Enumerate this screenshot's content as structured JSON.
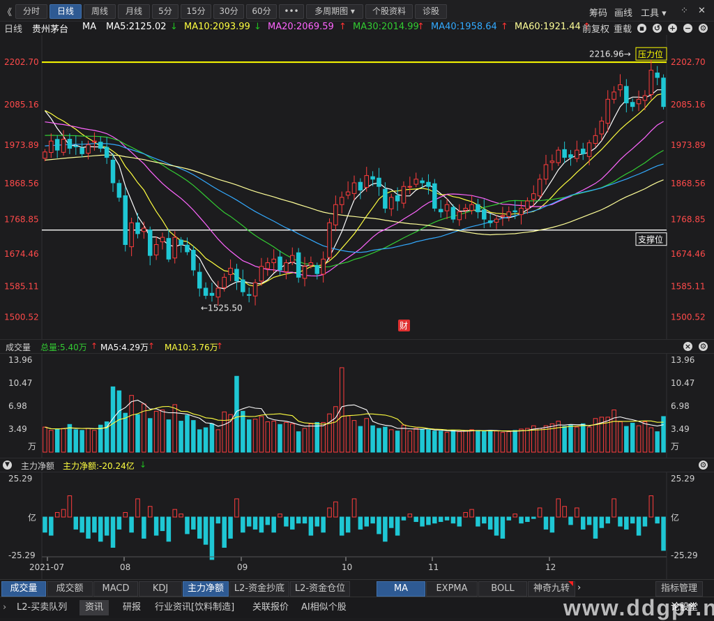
{
  "toolbar": {
    "back_glyph": "《",
    "tabs": [
      {
        "label": "分时",
        "w": 44
      },
      {
        "label": "日线",
        "w": 44,
        "active": true
      },
      {
        "label": "周线",
        "w": 44
      },
      {
        "label": "月线",
        "w": 44
      },
      {
        "label": "5分",
        "w": 36
      },
      {
        "label": "15分",
        "w": 42
      },
      {
        "label": "30分",
        "w": 42
      },
      {
        "label": "60分",
        "w": 42
      },
      {
        "label": "•••",
        "w": 34
      },
      {
        "label": "多周期图 ▾",
        "w": 80
      },
      {
        "label": "个股资料",
        "w": 66
      },
      {
        "label": "诊股",
        "w": 44
      }
    ],
    "right": {
      "chip": "筹码",
      "draw": "画线",
      "tools": "工具 ▾",
      "grid_icon": "⁘",
      "close_icon": "✕"
    }
  },
  "ma_bar": {
    "period": "日线",
    "stock": "贵州茅台",
    "indicator": "MA",
    "items": [
      {
        "label": "MA5:2125.02",
        "arrow": "↓",
        "color": "#ffffff",
        "arrow_color": "#20c020"
      },
      {
        "label": "MA10:2093.99",
        "arrow": "↓",
        "color": "#ffff40",
        "arrow_color": "#20c020"
      },
      {
        "label": "MA20:2069.59",
        "arrow": "↑",
        "color": "#ff66ff",
        "arrow_color": "#ff3333"
      },
      {
        "label": "MA30:2014.99",
        "arrow": "↑",
        "color": "#33cc33",
        "arrow_color": "#ff3333"
      },
      {
        "label": "MA40:1958.64",
        "arrow": "↑",
        "color": "#33aaff",
        "arrow_color": "#ff3333"
      },
      {
        "label": "MA60:1921.44",
        "arrow": "↑",
        "color": "#ffff99",
        "arrow_color": "#ff3333"
      }
    ],
    "right": {
      "adjust": "前复权",
      "overlay": "重载"
    }
  },
  "volume_bar": {
    "title": "成交量",
    "items": [
      {
        "label": "总量:5.40万",
        "arrow": "↑",
        "color": "#33cc33"
      },
      {
        "label": "MA5:4.29万",
        "arrow": "↑",
        "color": "#ffffff"
      },
      {
        "label": "MA10:3.76万",
        "arrow": "↑",
        "color": "#ffff40"
      }
    ]
  },
  "flow_bar": {
    "title": "主力净额",
    "value": "主力净额:-20.24亿",
    "arrow": "↓"
  },
  "bottom_tabs": [
    {
      "label": "成交量",
      "active": true,
      "w": 62
    },
    {
      "label": "成交额",
      "w": 64
    },
    {
      "label": "MACD",
      "w": 62
    },
    {
      "label": "KDJ",
      "w": 60
    },
    {
      "label": "主力净额",
      "active": true,
      "w": 64
    },
    {
      "label": "L2-资金抄底",
      "w": 84
    },
    {
      "label": "L2-资金仓位",
      "w": 84
    },
    {
      "label": "MA",
      "active": true,
      "w": 68
    },
    {
      "label": "EXPMA",
      "w": 72
    },
    {
      "label": "BOLL",
      "w": 68
    },
    {
      "label": "神奇九转",
      "w": 66
    }
  ],
  "bottom_right": "指标管理",
  "status_tabs": [
    {
      "label": "L2-买卖队列"
    },
    {
      "label": "资讯",
      "active": true
    },
    {
      "label": "研报"
    },
    {
      "label": "行业资讯[饮料制造]"
    },
    {
      "label": "关联报价"
    },
    {
      "label": "AI相似个股"
    }
  ],
  "status_right": "论股堂",
  "watermark": "www.ddgpr.net",
  "colors": {
    "up": "#ff3d3d",
    "down": "#1fc7d4",
    "support": "#ffffff",
    "resistance": "#ffff00"
  },
  "chart_data": [
    {
      "type": "candlestick",
      "title": "贵州茅台 日线",
      "y_ticks": [
        2202.7,
        2085.16,
        1973.89,
        1868.56,
        1768.85,
        1674.46,
        1585.11,
        1500.52
      ],
      "ylim": [
        1482,
        2235
      ],
      "x_ticks": [
        "2021-07",
        "08",
        "09",
        "10",
        "11",
        "12"
      ],
      "annotations": {
        "high_label": "2216.96",
        "low_label": "1525.50",
        "resistance_label": "压力位",
        "support_label": "支撑位",
        "event_marker": "财"
      },
      "resistance_level": 2202,
      "support_level": 1740,
      "closes": [
        1955,
        1985,
        1960,
        1990,
        1965,
        1970,
        1950,
        1975,
        1985,
        1965,
        1940,
        1870,
        1830,
        1700,
        1760,
        1730,
        1745,
        1670,
        1700,
        1720,
        1660,
        1720,
        1700,
        1680,
        1630,
        1580,
        1560,
        1560,
        1580,
        1610,
        1635,
        1600,
        1570,
        1560,
        1595,
        1640,
        1650,
        1660,
        1630,
        1650,
        1670,
        1610,
        1640,
        1650,
        1620,
        1660,
        1760,
        1810,
        1830,
        1845,
        1870,
        1850,
        1890,
        1880,
        1860,
        1800,
        1830,
        1820,
        1860,
        1860,
        1880,
        1870,
        1860,
        1800,
        1790,
        1810,
        1770,
        1790,
        1800,
        1810,
        1790,
        1770,
        1760,
        1770,
        1780,
        1790,
        1790,
        1800,
        1820,
        1840,
        1880,
        1920,
        1930,
        1960,
        1940,
        1940,
        1960,
        1950,
        1980,
        2000,
        2040,
        2100,
        2120,
        2140,
        2090,
        2080,
        2100,
        2110,
        2180,
        2160,
        2080
      ]
    },
    {
      "type": "bar",
      "title": "成交量",
      "unit": "万",
      "y_ticks": [
        13.96,
        10.47,
        6.98,
        3.49
      ],
      "ylim": [
        0,
        13.96
      ],
      "values": [
        3.8,
        3.3,
        3.5,
        3.6,
        4.2,
        3.4,
        3.3,
        3.6,
        3.3,
        4.1,
        4.6,
        9.9,
        9.3,
        5.9,
        8.6,
        5.7,
        7.3,
        5.1,
        6.2,
        6.4,
        4.9,
        7.2,
        4.7,
        5.6,
        4.8,
        3.4,
        3.7,
        4.3,
        3.4,
        6.1,
        5.7,
        11.5,
        6.2,
        4.9,
        5.0,
        5.4,
        4.6,
        4.7,
        4.2,
        4.5,
        4.3,
        3.1,
        3.6,
        4.3,
        4.5,
        4.5,
        5.8,
        6.9,
        12.8,
        5.5,
        4.8,
        3.9,
        5.1,
        4.0,
        3.6,
        3.8,
        3.4,
        3.2,
        4.1,
        3.2,
        3.6,
        3.4,
        3.4,
        3.2,
        3.2,
        3.0,
        3.3,
        3.1,
        3.3,
        3.4,
        3.3,
        3.2,
        3.3,
        3.2,
        3.0,
        3.1,
        3.3,
        3.5,
        3.6,
        4.0,
        3.6,
        4.0,
        4.3,
        4.7,
        3.9,
        4.1,
        3.8,
        4.3,
        3.8,
        5.1,
        5.3,
        5.3,
        6.4,
        4.6,
        3.9,
        4.4,
        4.0,
        4.6,
        3.7,
        3.1,
        5.4
      ]
    },
    {
      "type": "bar",
      "title": "主力净额",
      "unit": "亿",
      "y_ticks": [
        25.29,
        -25.29
      ],
      "ylim": [
        -25.29,
        25.29
      ],
      "values": [
        -10.0,
        -12.0,
        3.0,
        5.0,
        14.0,
        -8.0,
        -10.0,
        -14.0,
        -10.0,
        -16.0,
        -12.0,
        -20.0,
        -8.0,
        3.0,
        -10.0,
        12.0,
        -14.0,
        7.0,
        -12.0,
        -9.0,
        -16.0,
        5.0,
        2.0,
        -11.0,
        -8.0,
        -14.0,
        -18.0,
        -28.0,
        -4.0,
        -20.0,
        -14.0,
        12.0,
        -10.0,
        -6.0,
        -8.0,
        -10.0,
        -5.0,
        -10.0,
        2.0,
        -6.0,
        -8.0,
        -4.0,
        -4.0,
        -12.0,
        -6.0,
        -10.0,
        6.0,
        10.0,
        -12.0,
        -10.0,
        12.0,
        -8.0,
        -6.0,
        -4.0,
        -11.0,
        -16.0,
        -7.0,
        -12.0,
        -2.0,
        2.0,
        -3.0,
        -6.0,
        -5.0,
        -4.0,
        -3.0,
        -2.0,
        -4.0,
        -6.0,
        3.0,
        5.0,
        -6.0,
        -4.0,
        -8.0,
        -12.0,
        -14.0,
        -2.0,
        2.0,
        -4.0,
        -3.0,
        -1.0,
        6.0,
        -8.0,
        -10.0,
        12.0,
        7.0,
        -5.0,
        6.0,
        -8.0,
        -5.0,
        -14.0,
        -7.0,
        -4.0,
        12.0,
        -6.0,
        -8.0,
        -4.0,
        -12.0,
        -6.0,
        14.0,
        -4.0,
        -22.0
      ]
    }
  ]
}
